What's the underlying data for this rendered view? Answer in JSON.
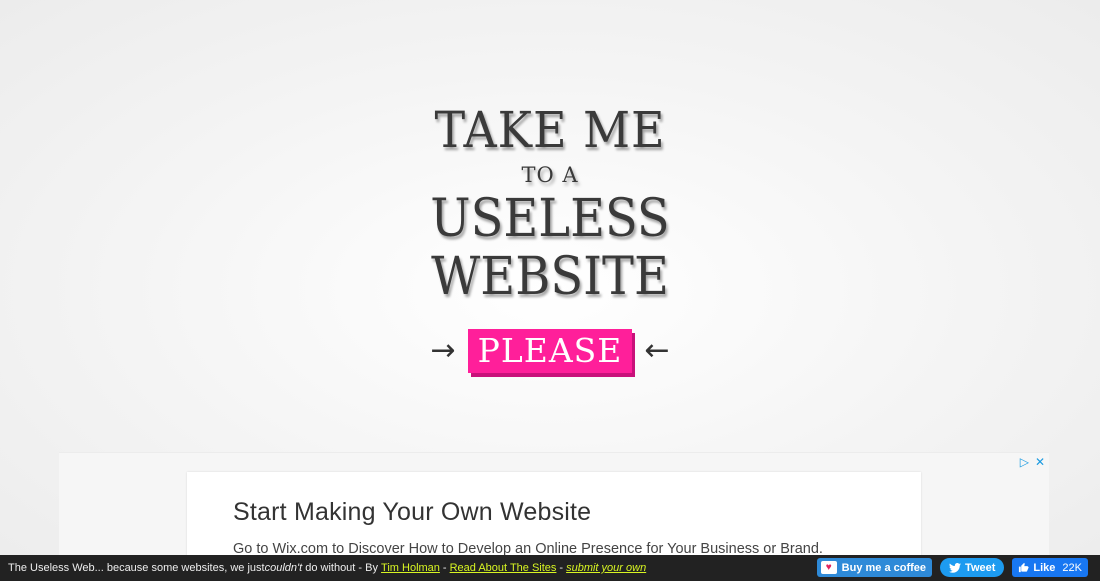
{
  "title": {
    "line1": "TAKE ME",
    "line2": "TO A",
    "line3": "USELESS",
    "line4": "WEBSITE"
  },
  "cta": {
    "label": "PLEASE",
    "left_arrow": "→",
    "right_arrow": "←",
    "color": "#ff1f9a"
  },
  "ad": {
    "headline": "Start Making Your Own Website",
    "text": "Go to Wix.com to Discover How to Develop an Online Presence for Your Business or Brand.",
    "adchoices_icon": "▷",
    "close_icon": "✕"
  },
  "footer": {
    "prefix": "The Useless Web... because some websites, we just ",
    "emphasis": "couldn't",
    "middle": " do without - By ",
    "author_link": "Tim Holman",
    "sep1": "-",
    "about_link": "Read About The Sites",
    "sep2": "-",
    "submit_link": "submit your own",
    "coffee_label": "Buy me a coffee",
    "tweet_label": "Tweet",
    "like_label": "Like",
    "like_count": "22K"
  }
}
